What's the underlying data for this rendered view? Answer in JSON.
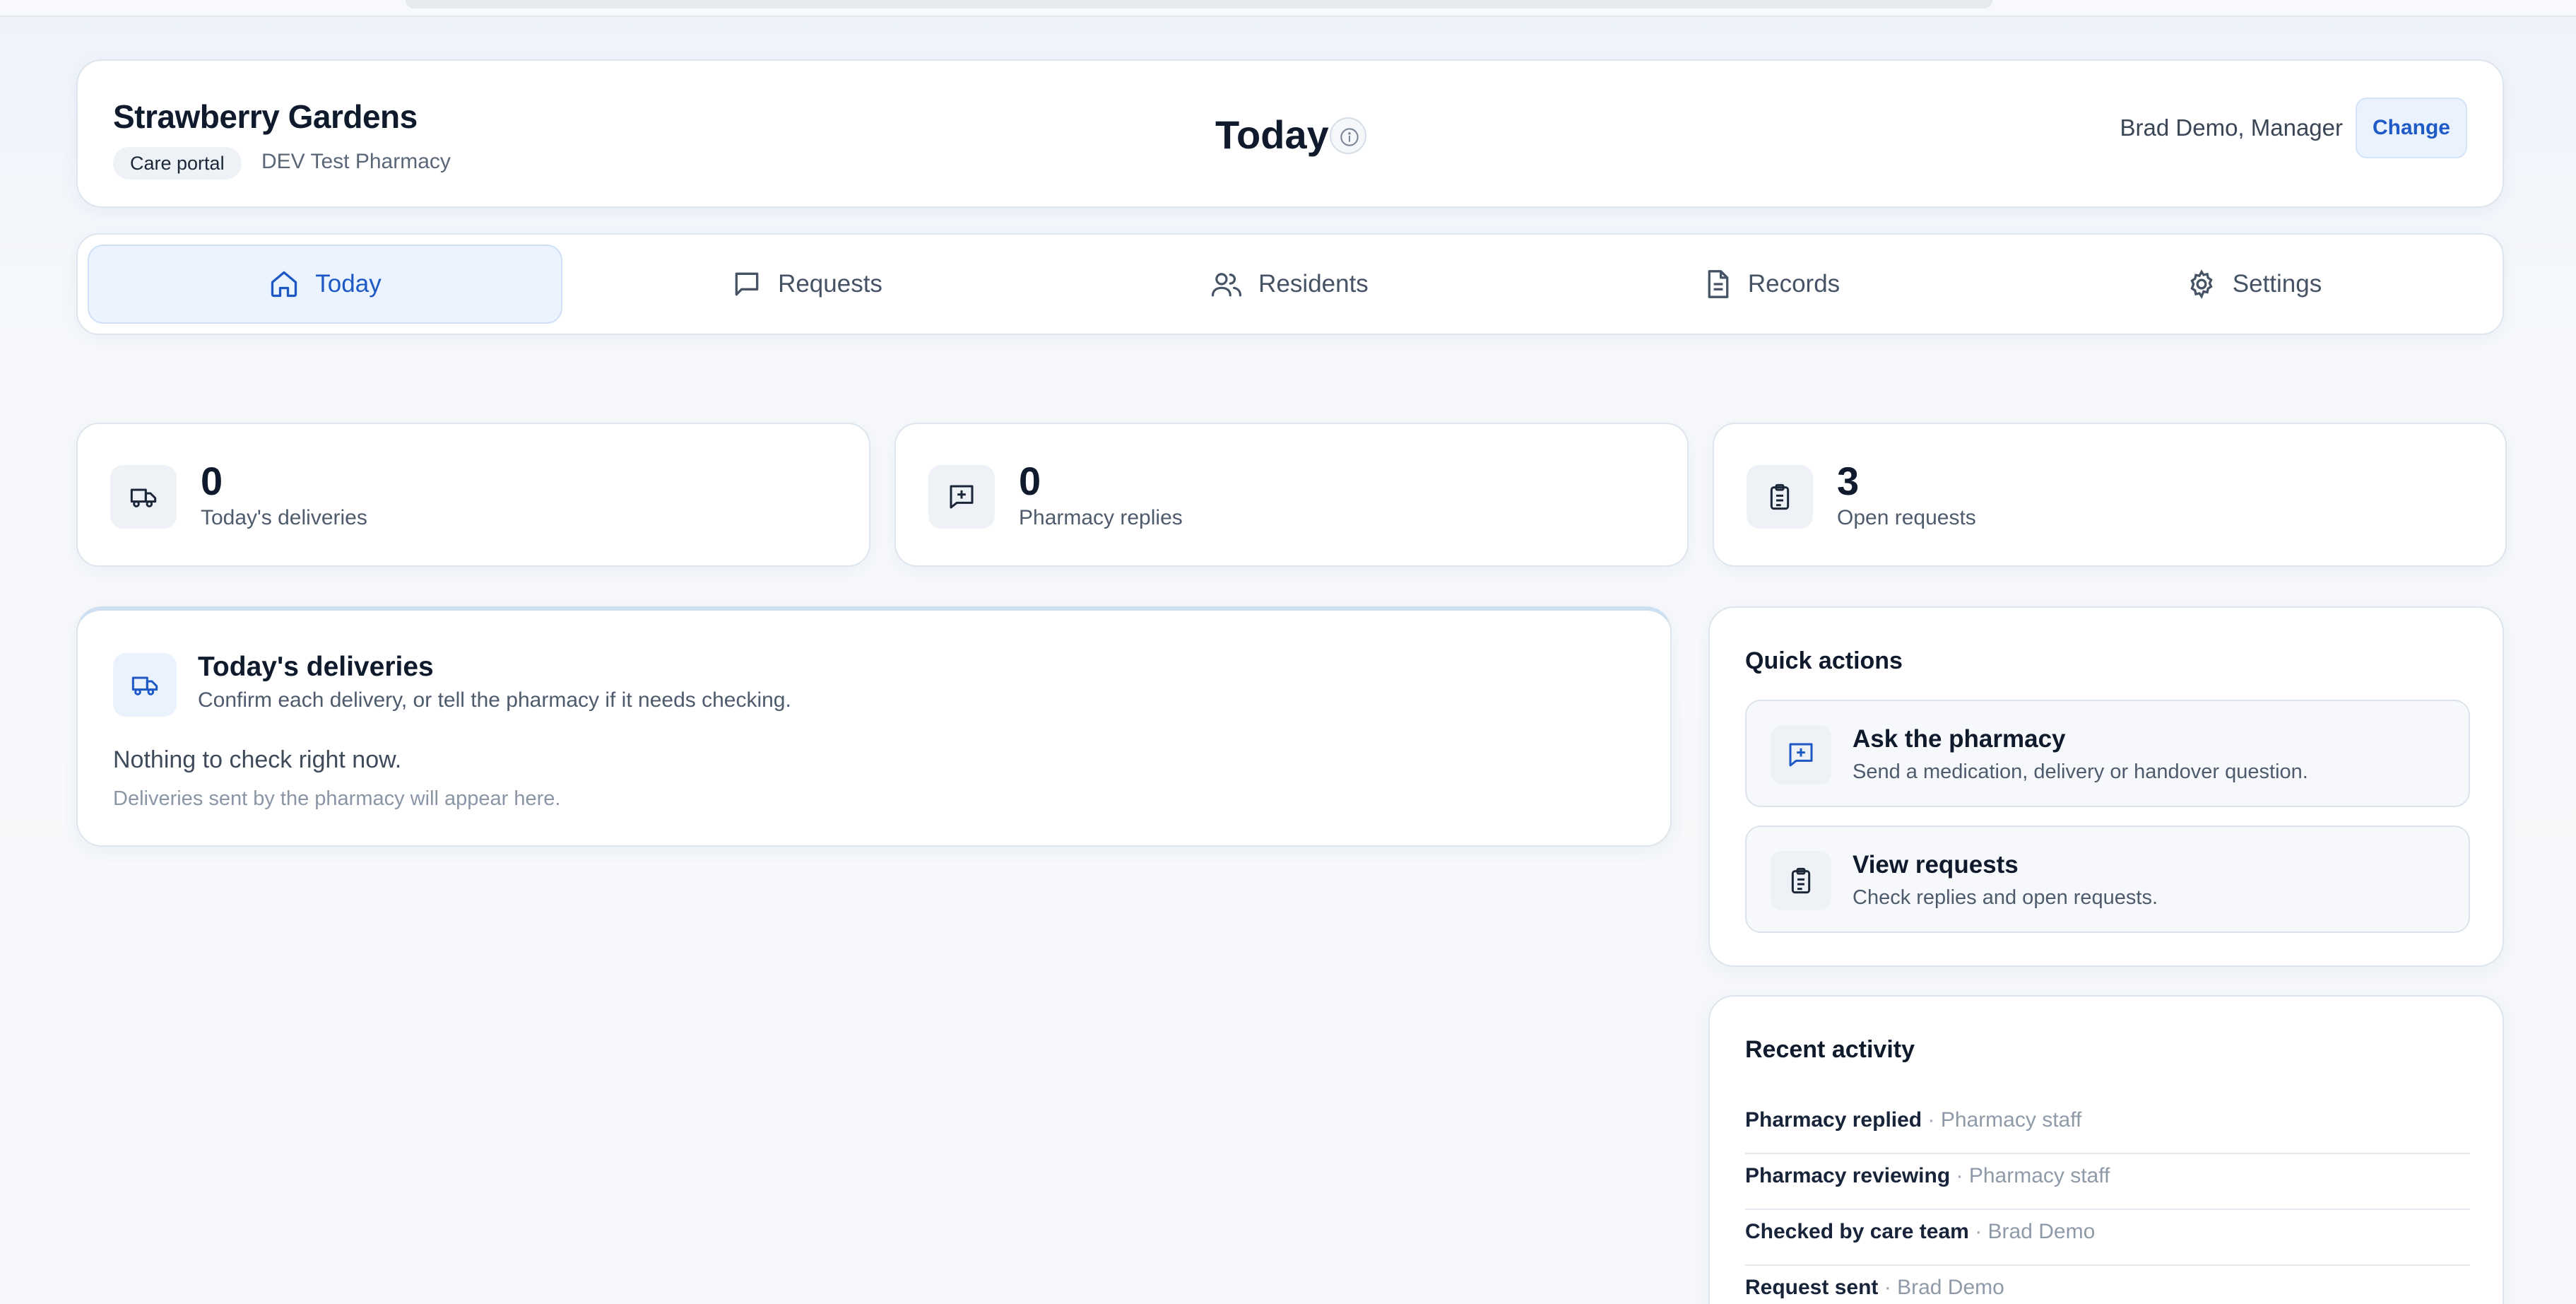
{
  "header": {
    "site_name": "Strawberry Gardens",
    "portal_badge": "Care portal",
    "pharmacy_name": "DEV Test Pharmacy",
    "page_title": "Today",
    "user_label": "Brad Demo, Manager",
    "change_label": "Change"
  },
  "nav": {
    "tabs": [
      {
        "label": "Today",
        "icon": "home-icon",
        "active": true
      },
      {
        "label": "Requests",
        "icon": "message-icon",
        "active": false
      },
      {
        "label": "Residents",
        "icon": "users-icon",
        "active": false
      },
      {
        "label": "Records",
        "icon": "document-icon",
        "active": false
      },
      {
        "label": "Settings",
        "icon": "gear-icon",
        "active": false
      }
    ]
  },
  "stats": [
    {
      "value": "0",
      "label": "Today's deliveries",
      "icon": "truck-icon"
    },
    {
      "value": "0",
      "label": "Pharmacy replies",
      "icon": "message-plus-icon"
    },
    {
      "value": "3",
      "label": "Open requests",
      "icon": "clipboard-icon"
    }
  ],
  "deliveries": {
    "title": "Today's deliveries",
    "subtitle": "Confirm each delivery, or tell the pharmacy if it needs checking.",
    "empty_text": "Nothing to check right now.",
    "hint": "Deliveries sent by the pharmacy will appear here.",
    "icon": "truck-icon"
  },
  "quick_actions": {
    "title": "Quick actions",
    "items": [
      {
        "title": "Ask the pharmacy",
        "subtitle": "Send a medication, delivery or handover question.",
        "icon": "message-plus-icon"
      },
      {
        "title": "View requests",
        "subtitle": "Check replies and open requests.",
        "icon": "clipboard-icon"
      }
    ]
  },
  "recent_activity": {
    "title": "Recent activity",
    "separator": "·",
    "items": [
      {
        "event": "Pharmacy replied",
        "by": "Pharmacy staff"
      },
      {
        "event": "Pharmacy reviewing",
        "by": "Pharmacy staff"
      },
      {
        "event": "Checked by care team",
        "by": "Brad Demo"
      },
      {
        "event": "Request sent",
        "by": "Brad Demo"
      }
    ]
  },
  "colors": {
    "accent": "#1d58c4",
    "accent_bg": "#eaf3fe",
    "page_bg": "#f5f7fa",
    "text": "#0f1b2d"
  }
}
